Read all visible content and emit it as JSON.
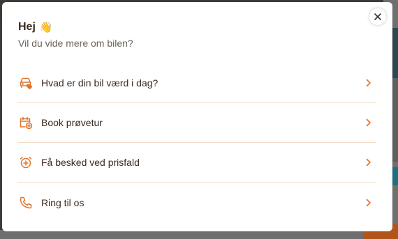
{
  "colors": {
    "accent": "#e0742a",
    "text": "#3b2a1f",
    "subtext": "#6a625a",
    "divider": "#f1dfcc"
  },
  "modal": {
    "title": "Hej",
    "title_emoji": "👋",
    "subtitle": "Vil du vide mere om bilen?",
    "close_icon": "close-icon"
  },
  "menu": {
    "items": [
      {
        "label": "Hvad er din bil værd i dag?",
        "icon": "car-tag-icon"
      },
      {
        "label": "Book prøvetur",
        "icon": "calendar-car-icon"
      },
      {
        "label": "Få besked ved prisfald",
        "icon": "alarm-clock-icon"
      },
      {
        "label": "Ring til os",
        "icon": "phone-icon"
      }
    ]
  }
}
